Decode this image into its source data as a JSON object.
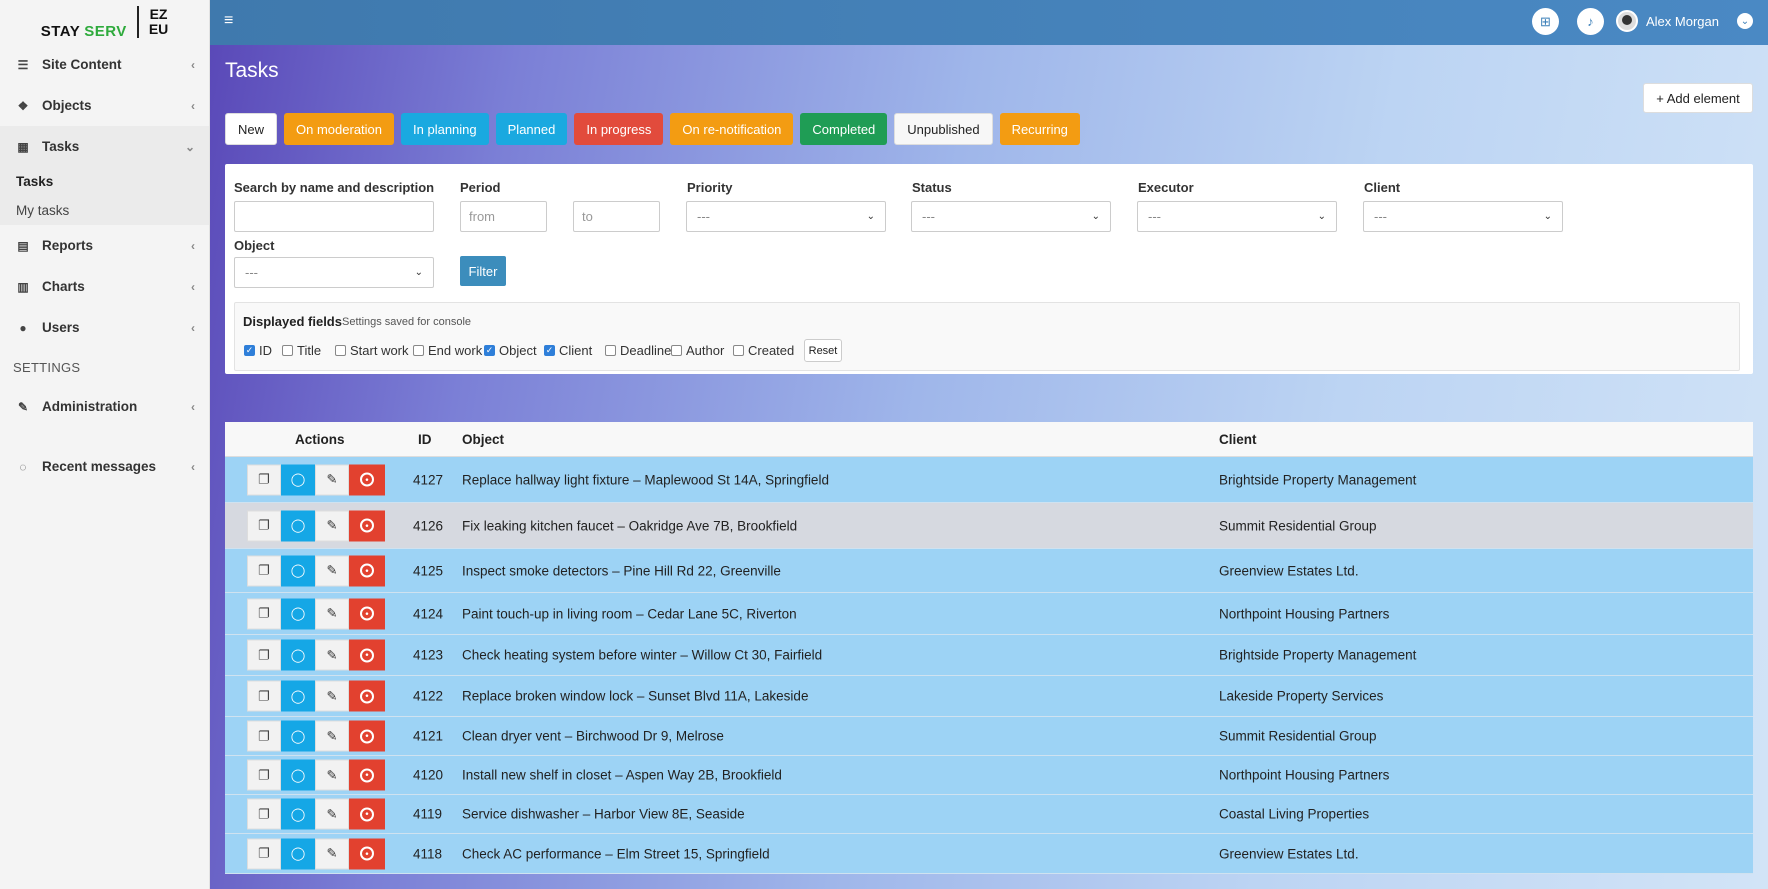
{
  "logo": {
    "stay": "STAY",
    "serv": "SERV",
    "ez": "EZ",
    "eu": "EU"
  },
  "sidebar": {
    "items": [
      {
        "label": "Site Content",
        "icon": "list-icon"
      },
      {
        "label": "Objects",
        "icon": "objects-icon"
      },
      {
        "label": "Tasks",
        "icon": "calendar-icon"
      },
      {
        "label": "Reports",
        "icon": "table-icon"
      },
      {
        "label": "Charts",
        "icon": "bar-chart-icon"
      },
      {
        "label": "Users",
        "icon": "user-icon"
      },
      {
        "label": "Administration",
        "icon": "wrench-icon"
      },
      {
        "label": "Recent messages",
        "icon": "comments-icon"
      }
    ],
    "subitems": [
      {
        "label": "Tasks"
      },
      {
        "label": "My tasks"
      }
    ],
    "settings_header": "SETTINGS"
  },
  "topbar": {
    "user_name": "Alex Morgan"
  },
  "page": {
    "title": "Tasks",
    "add_button": "+ Add element"
  },
  "status_buttons": [
    {
      "label": "New",
      "color": "#ffffff",
      "text_color": "#222222"
    },
    {
      "label": "On moderation",
      "color": "#f39c12",
      "text_color": "#ffffff"
    },
    {
      "label": "In planning",
      "color": "#1aa9e0",
      "text_color": "#ffffff"
    },
    {
      "label": "Planned",
      "color": "#1aa9e0",
      "text_color": "#ffffff"
    },
    {
      "label": "In progress",
      "color": "#e24b3c",
      "text_color": "#ffffff"
    },
    {
      "label": "On re-notification",
      "color": "#f39c12",
      "text_color": "#ffffff"
    },
    {
      "label": "Completed",
      "color": "#1f9d55",
      "text_color": "#ffffff"
    },
    {
      "label": "Unpublished",
      "color": "#f7f7f7",
      "text_color": "#222222"
    },
    {
      "label": "Recurring",
      "color": "#f39c12",
      "text_color": "#ffffff"
    }
  ],
  "filters": {
    "search_label": "Search by name and description",
    "period_label": "Period",
    "period_from": "from",
    "period_to": "to",
    "priority_label": "Priority",
    "status_label": "Status",
    "executor_label": "Executor",
    "client_label": "Client",
    "object_label": "Object",
    "select_value": "---",
    "filter_button": "Filter"
  },
  "displayed_fields": {
    "title": "Displayed fields",
    "note": "Settings saved for console",
    "fields": [
      {
        "label": "ID",
        "checked": true
      },
      {
        "label": "Title",
        "checked": false
      },
      {
        "label": "Start work",
        "checked": false
      },
      {
        "label": "End work",
        "checked": false
      },
      {
        "label": "Object",
        "checked": true
      },
      {
        "label": "Client",
        "checked": true
      },
      {
        "label": "Deadline",
        "checked": false
      },
      {
        "label": "Author",
        "checked": false
      },
      {
        "label": "Created",
        "checked": false
      }
    ],
    "reset_button": "Reset"
  },
  "table": {
    "headers": {
      "actions": "Actions",
      "id": "ID",
      "object": "Object",
      "client": "Client"
    },
    "rows": [
      {
        "id": "4127",
        "object": "Replace hallway light fixture – Maplewood St 14A, Springfield",
        "client": "Brightside Property Management"
      },
      {
        "id": "4126",
        "object": "Fix leaking kitchen faucet – Oakridge Ave 7B, Brookfield",
        "client": "Summit Residential Group"
      },
      {
        "id": "4125",
        "object": "Inspect smoke detectors – Pine Hill Rd 22, Greenville",
        "client": "Greenview Estates Ltd."
      },
      {
        "id": "4124",
        "object": "Paint touch-up in living room – Cedar Lane 5C, Riverton",
        "client": "Northpoint Housing Partners"
      },
      {
        "id": "4123",
        "object": "Check heating system before winter – Willow Ct 30, Fairfield",
        "client": "Brightside Property Management"
      },
      {
        "id": "4122",
        "object": "Replace broken window lock – Sunset Blvd 11A, Lakeside",
        "client": "Lakeside Property Services"
      },
      {
        "id": "4121",
        "object": "Clean dryer vent – Birchwood Dr 9, Melrose",
        "client": "Summit Residential Group"
      },
      {
        "id": "4120",
        "object": "Install new shelf in closet – Aspen Way 2B, Brookfield",
        "client": "Northpoint Housing Partners"
      },
      {
        "id": "4119",
        "object": "Service dishwasher – Harbor View 8E, Seaside",
        "client": "Coastal Living Properties"
      },
      {
        "id": "4118",
        "object": "Check AC performance – Elm Street 15, Springfield",
        "client": "Greenview Estates Ltd."
      }
    ]
  }
}
